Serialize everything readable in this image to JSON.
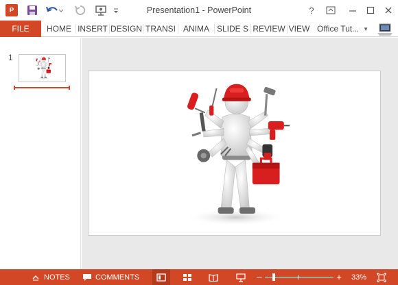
{
  "app": {
    "icon_label": "P",
    "window_title": "Presentation1 - PowerPoint"
  },
  "quick_access": {
    "icons": [
      "powerpoint-app-icon",
      "save-icon",
      "undo-icon",
      "redo-icon",
      "start-from-beginning-icon",
      "customize-toolbar-icon"
    ]
  },
  "window_controls": {
    "help_label": "?",
    "icons": [
      "ribbon-display-options-icon",
      "minimize-icon",
      "maximize-icon",
      "close-icon"
    ]
  },
  "ribbon": {
    "file_tab": "FILE",
    "tabs": [
      "HOME",
      "INSERT",
      "DESIGN",
      "TRANSI",
      "ANIMA",
      "SLIDE S",
      "REVIEW",
      "VIEW"
    ],
    "account_name": "Office Tut..."
  },
  "thumbnails": {
    "slides": [
      {
        "number": "1"
      }
    ]
  },
  "statusbar": {
    "notes_label": "NOTES",
    "comments_label": "COMMENTS",
    "zoom_level": "33%",
    "zoom_percent": 33,
    "active_view": "normal"
  },
  "colors": {
    "accent": "#d24726",
    "accent_dark": "#b33a1d",
    "editing_background": "#e9e9e9"
  }
}
